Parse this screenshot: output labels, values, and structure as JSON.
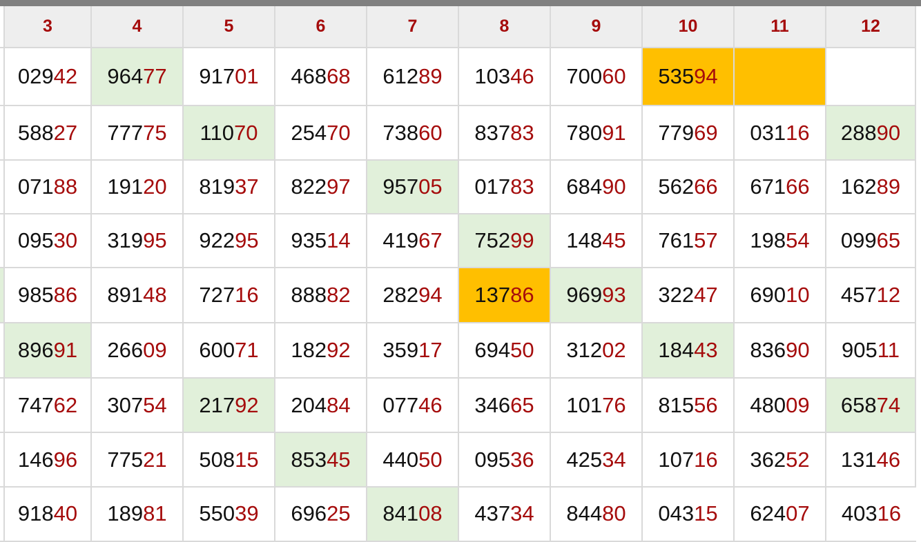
{
  "colors": {
    "header_bg": "#eeeeee",
    "header_text": "#a50c0c",
    "green_highlight": "#e1f0da",
    "orange_highlight": "#ffbf00",
    "tail_digit": "#a50c0c",
    "grid_line": "#d9d9d9"
  },
  "columns": [
    "3",
    "4",
    "5",
    "6",
    "7",
    "8",
    "9",
    "10",
    "11",
    "12"
  ],
  "rows": [
    [
      {
        "h": "029",
        "t": "42"
      },
      {
        "h": "964",
        "t": "77",
        "hl": "green"
      },
      {
        "h": "917",
        "t": "01"
      },
      {
        "h": "468",
        "t": "68"
      },
      {
        "h": "612",
        "t": "89"
      },
      {
        "h": "103",
        "t": "46"
      },
      {
        "h": "700",
        "t": "60"
      },
      {
        "h": "535",
        "t": "94",
        "hl": "orange"
      },
      {
        "h": "",
        "t": "",
        "hl": "orange"
      },
      {
        "h": "",
        "t": ""
      }
    ],
    [
      {
        "h": "588",
        "t": "27"
      },
      {
        "h": "777",
        "t": "75"
      },
      {
        "h": "110",
        "t": "70",
        "hl": "green"
      },
      {
        "h": "254",
        "t": "70"
      },
      {
        "h": "738",
        "t": "60"
      },
      {
        "h": "837",
        "t": "83"
      },
      {
        "h": "780",
        "t": "91"
      },
      {
        "h": "779",
        "t": "69"
      },
      {
        "h": "031",
        "t": "16"
      },
      {
        "h": "288",
        "t": "90",
        "hl": "green"
      }
    ],
    [
      {
        "h": "071",
        "t": "88"
      },
      {
        "h": "191",
        "t": "20"
      },
      {
        "h": "819",
        "t": "37"
      },
      {
        "h": "822",
        "t": "97"
      },
      {
        "h": "957",
        "t": "05",
        "hl": "green"
      },
      {
        "h": "017",
        "t": "83"
      },
      {
        "h": "684",
        "t": "90"
      },
      {
        "h": "562",
        "t": "66"
      },
      {
        "h": "671",
        "t": "66"
      },
      {
        "h": "162",
        "t": "89"
      }
    ],
    [
      {
        "h": "095",
        "t": "30"
      },
      {
        "h": "319",
        "t": "95"
      },
      {
        "h": "922",
        "t": "95"
      },
      {
        "h": "935",
        "t": "14"
      },
      {
        "h": "419",
        "t": "67"
      },
      {
        "h": "752",
        "t": "99",
        "hl": "green"
      },
      {
        "h": "148",
        "t": "45"
      },
      {
        "h": "761",
        "t": "57"
      },
      {
        "h": "198",
        "t": "54"
      },
      {
        "h": "099",
        "t": "65"
      }
    ],
    [
      {
        "h": "985",
        "t": "86"
      },
      {
        "h": "891",
        "t": "48"
      },
      {
        "h": "727",
        "t": "16"
      },
      {
        "h": "888",
        "t": "82"
      },
      {
        "h": "282",
        "t": "94"
      },
      {
        "h": "137",
        "t": "86",
        "hl": "orange"
      },
      {
        "h": "969",
        "t": "93",
        "hl": "green"
      },
      {
        "h": "322",
        "t": "47"
      },
      {
        "h": "690",
        "t": "10"
      },
      {
        "h": "457",
        "t": "12"
      }
    ],
    [
      {
        "h": "896",
        "t": "91",
        "hl": "green"
      },
      {
        "h": "266",
        "t": "09"
      },
      {
        "h": "600",
        "t": "71"
      },
      {
        "h": "182",
        "t": "92"
      },
      {
        "h": "359",
        "t": "17"
      },
      {
        "h": "694",
        "t": "50"
      },
      {
        "h": "312",
        "t": "02"
      },
      {
        "h": "184",
        "t": "43",
        "hl": "green"
      },
      {
        "h": "836",
        "t": "90"
      },
      {
        "h": "905",
        "t": "11"
      }
    ],
    [
      {
        "h": "747",
        "t": "62"
      },
      {
        "h": "307",
        "t": "54"
      },
      {
        "h": "217",
        "t": "92",
        "hl": "green"
      },
      {
        "h": "204",
        "t": "84"
      },
      {
        "h": "077",
        "t": "46"
      },
      {
        "h": "346",
        "t": "65"
      },
      {
        "h": "101",
        "t": "76"
      },
      {
        "h": "815",
        "t": "56"
      },
      {
        "h": "480",
        "t": "09"
      },
      {
        "h": "658",
        "t": "74",
        "hl": "green"
      }
    ],
    [
      {
        "h": "146",
        "t": "96"
      },
      {
        "h": "775",
        "t": "21"
      },
      {
        "h": "508",
        "t": "15"
      },
      {
        "h": "853",
        "t": "45",
        "hl": "green"
      },
      {
        "h": "440",
        "t": "50"
      },
      {
        "h": "095",
        "t": "36"
      },
      {
        "h": "425",
        "t": "34"
      },
      {
        "h": "107",
        "t": "16"
      },
      {
        "h": "362",
        "t": "52"
      },
      {
        "h": "131",
        "t": "46"
      }
    ],
    [
      {
        "h": "918",
        "t": "40"
      },
      {
        "h": "189",
        "t": "81"
      },
      {
        "h": "550",
        "t": "39"
      },
      {
        "h": "696",
        "t": "25"
      },
      {
        "h": "841",
        "t": "08",
        "hl": "green"
      },
      {
        "h": "437",
        "t": "34"
      },
      {
        "h": "844",
        "t": "80"
      },
      {
        "h": "043",
        "t": "15"
      },
      {
        "h": "624",
        "t": "07"
      },
      {
        "h": "403",
        "t": "16"
      }
    ]
  ],
  "left_edge_green_rows": [
    4
  ]
}
